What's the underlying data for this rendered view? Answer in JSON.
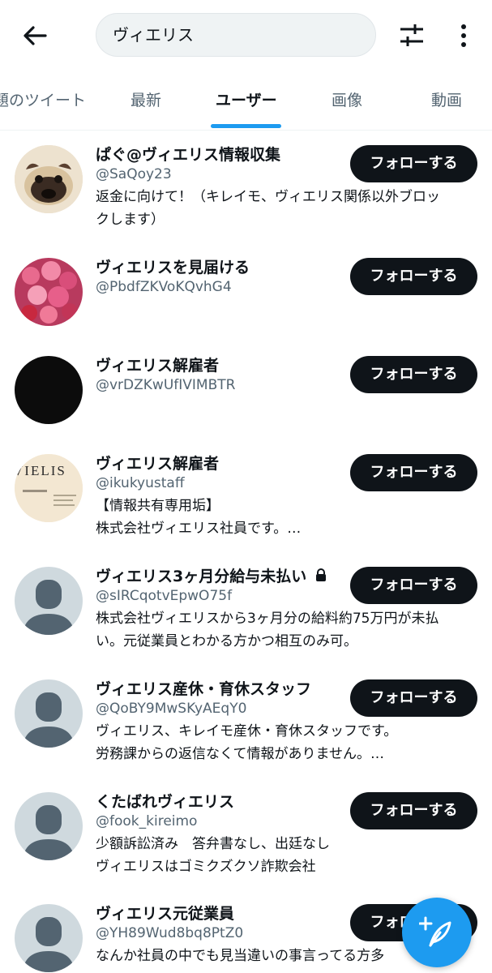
{
  "header": {
    "search_value": "ヴィエリス",
    "back_icon": "arrow-left-icon",
    "filter_icon": "sliders-icon",
    "more_icon": "more-vertical-icon"
  },
  "tabs": [
    {
      "label": "題のツイート",
      "active": false
    },
    {
      "label": "最新",
      "active": false
    },
    {
      "label": "ユーザー",
      "active": true
    },
    {
      "label": "画像",
      "active": false
    },
    {
      "label": "動画",
      "active": false
    }
  ],
  "follow_label": "フォローする",
  "users": [
    {
      "name": "ぱぐ@ヴィエリス情報収集",
      "handle": "@SaQoy23",
      "bio": [
        "返金に向けて！（キレイモ、ヴィエリス関係以外ブロッ",
        "クします）"
      ],
      "avatar": "pug-photo"
    },
    {
      "name": "ヴィエリスを見届ける",
      "handle": "@PbdfZKVoKQvhG4",
      "bio": [],
      "avatar": "flower-bouquet-photo"
    },
    {
      "name": "ヴィエリス解雇者",
      "handle": "@vrDZKwUfIVIMBTR",
      "bio": [],
      "avatar": "black-circle"
    },
    {
      "name": "ヴィエリス解雇者",
      "handle": "@ikukyustaff",
      "bio": [
        "【情報共有専用垢】",
        "株式会社ヴィエリス社員です。…"
      ],
      "avatar": "document-photo",
      "avatar_text": "VIELIS"
    },
    {
      "name": "ヴィエリス3ヶ月分給与未払い",
      "handle": "@sIRCqotvEpwO75f",
      "bio": [
        "株式会社ヴィエリスから3ヶ月分の給料約75万円が未払",
        "い。元従業員とわかる方かつ相互のみ可。"
      ],
      "avatar": "default",
      "locked": true
    },
    {
      "name": "ヴィエリス産休・育休スタッフ",
      "handle": "@QoBY9MwSKyAEqY0",
      "bio": [
        "ヴィエリス、キレイモ産休・育休スタッフです。",
        "労務課からの返信なくて情報がありません。…"
      ],
      "avatar": "default"
    },
    {
      "name": "くたばれヴィエリス",
      "handle": "@fook_kireimo",
      "bio": [
        "少額訴訟済み　答弁書なし、出廷なし",
        "ヴィエリスはゴミクズクソ詐欺会社"
      ],
      "avatar": "default"
    },
    {
      "name": "ヴィエリス元従業員",
      "handle": "@YH89Wud8bq8PtZ0",
      "bio": [
        "なんか社員の中でも見当違いの事言ってる方多"
      ],
      "avatar": "default"
    }
  ],
  "fab_icon": "compose-tweet-icon"
}
